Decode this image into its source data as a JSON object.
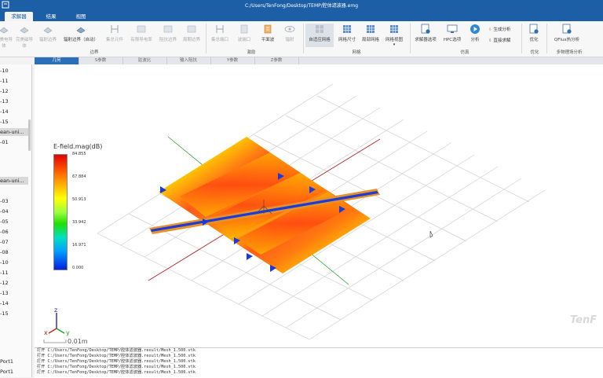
{
  "window": {
    "title": "C:/Users/TenFong/Desktop/TEMP/腔体滤波器.emg"
  },
  "menu": [
    {
      "label": "求解器",
      "active": true
    },
    {
      "label": "结果",
      "active": false
    },
    {
      "label": "视图",
      "active": false
    }
  ],
  "ribbon": {
    "buttons": [
      {
        "label": "完美电导体",
        "name": "pec-button",
        "dim": true,
        "icon": "boundary-icon"
      },
      {
        "label": "完美磁导体",
        "name": "pmc-button",
        "dim": true,
        "icon": "boundary-icon"
      },
      {
        "label": "辐射边界",
        "name": "radiation-boundary-button",
        "dim": true,
        "icon": "boundary-icon"
      },
      {
        "label": "辐射边界（自动）",
        "name": "radiation-auto-button",
        "dim": false,
        "icon": "boundary-icon"
      },
      {
        "label": "集总元件",
        "name": "lumped-element-button",
        "dim": true,
        "icon": "lumped-icon"
      },
      {
        "label": "有限导电率",
        "name": "finite-conductivity-button",
        "dim": true,
        "icon": "conductivity-icon"
      },
      {
        "label": "阻抗边界",
        "name": "impedance-boundary-button",
        "dim": true,
        "icon": "impedance-icon"
      },
      {
        "label": "周期边界",
        "name": "periodic-boundary-button",
        "dim": true,
        "icon": "periodic-icon"
      },
      {
        "label": "集总端口",
        "name": "lumped-port-button",
        "dim": true,
        "icon": "port-icon"
      },
      {
        "label": "波端口",
        "name": "wave-port-button",
        "dim": true,
        "icon": "waveport-icon"
      },
      {
        "label": "平面波",
        "name": "plane-wave-button",
        "dim": false,
        "icon": "planewave-icon"
      },
      {
        "label": "辐射",
        "name": "radiation-source-button",
        "dim": true,
        "icon": "eye-icon"
      },
      {
        "label": "自适应网格",
        "name": "adaptive-mesh-button",
        "dim": false,
        "icon": "mesh-icon"
      },
      {
        "label": "网格尺寸",
        "name": "mesh-size-button",
        "dim": false,
        "icon": "grid-icon"
      },
      {
        "label": "局部网格",
        "name": "local-mesh-button",
        "dim": false,
        "icon": "grid-icon"
      },
      {
        "label": "网格视图",
        "name": "mesh-view-button",
        "dim": false,
        "icon": "grid-icon"
      },
      {
        "label": "求解器选项",
        "name": "solver-options-button",
        "dim": false,
        "icon": "solver-icon"
      },
      {
        "label": "HPC选项",
        "name": "hpc-options-button",
        "dim": false,
        "icon": "hpc-icon"
      },
      {
        "label": "分析",
        "name": "analyze-button",
        "dim": false,
        "icon": "play-icon"
      },
      {
        "label": "优化",
        "name": "optimize-button",
        "dim": false,
        "icon": "optimize-icon"
      },
      {
        "label": "QFlux热分析",
        "name": "qflux-button",
        "dim": false,
        "icon": "qflux-icon"
      }
    ],
    "small": {
      "generate": "生成分析",
      "direct": "直接求解"
    },
    "groups": {
      "boundary": "边界",
      "excitation": "激励",
      "mesh": "网格",
      "simulation": "仿真",
      "optimize": "优化",
      "multiphysics": "多物理场分析"
    }
  },
  "subtabs": [
    "几何",
    "S参数",
    "驻波比",
    "输入阻抗",
    "Y参数",
    "Z参数"
  ],
  "sidebar": {
    "items": [
      "-10",
      "-11",
      "-12",
      "-13",
      "-14",
      "-15",
      "ean-uni...",
      "-01",
      "",
      "",
      "ean-uni...",
      "",
      "-03",
      "-04",
      "-05",
      "-06",
      "-07",
      "-08",
      "-10",
      "-11",
      "-12",
      "-13",
      "-14",
      "-15"
    ],
    "ports": [
      "Port1",
      "Port1"
    ]
  },
  "legend": {
    "title": "E-field.mag(dB)",
    "ticks": [
      "84.855",
      "67.884",
      "50.913",
      "33.942",
      "16.971",
      "0.000"
    ]
  },
  "scale": "0.01m",
  "axes": {
    "x": "x",
    "y": "y",
    "z": "z"
  },
  "watermark": "TenF",
  "log": [
    "打开 C:/Users/TenFong/Desktop/TEMP/腔体滤波器.result/Mesh_1.500.vtk",
    "打开 C:/Users/TenFong/Desktop/TEMP/腔体滤波器.result/Mesh_1.500.vtk",
    "打开 C:/Users/TenFong/Desktop/TEMP/腔体滤波器.result/Mesh_1.500.vtk",
    "打开 C:/Users/TenFong/Desktop/TEMP/腔体滤波器.result/Mesh_1.500.vtk",
    "打开 C:/Users/TenFong/Desktop/TEMP/腔体滤波器.result/Mesh_1.500.vtk"
  ],
  "colors": {
    "titlebar": "#1c5fa6",
    "accent": "#2d6fb7"
  }
}
